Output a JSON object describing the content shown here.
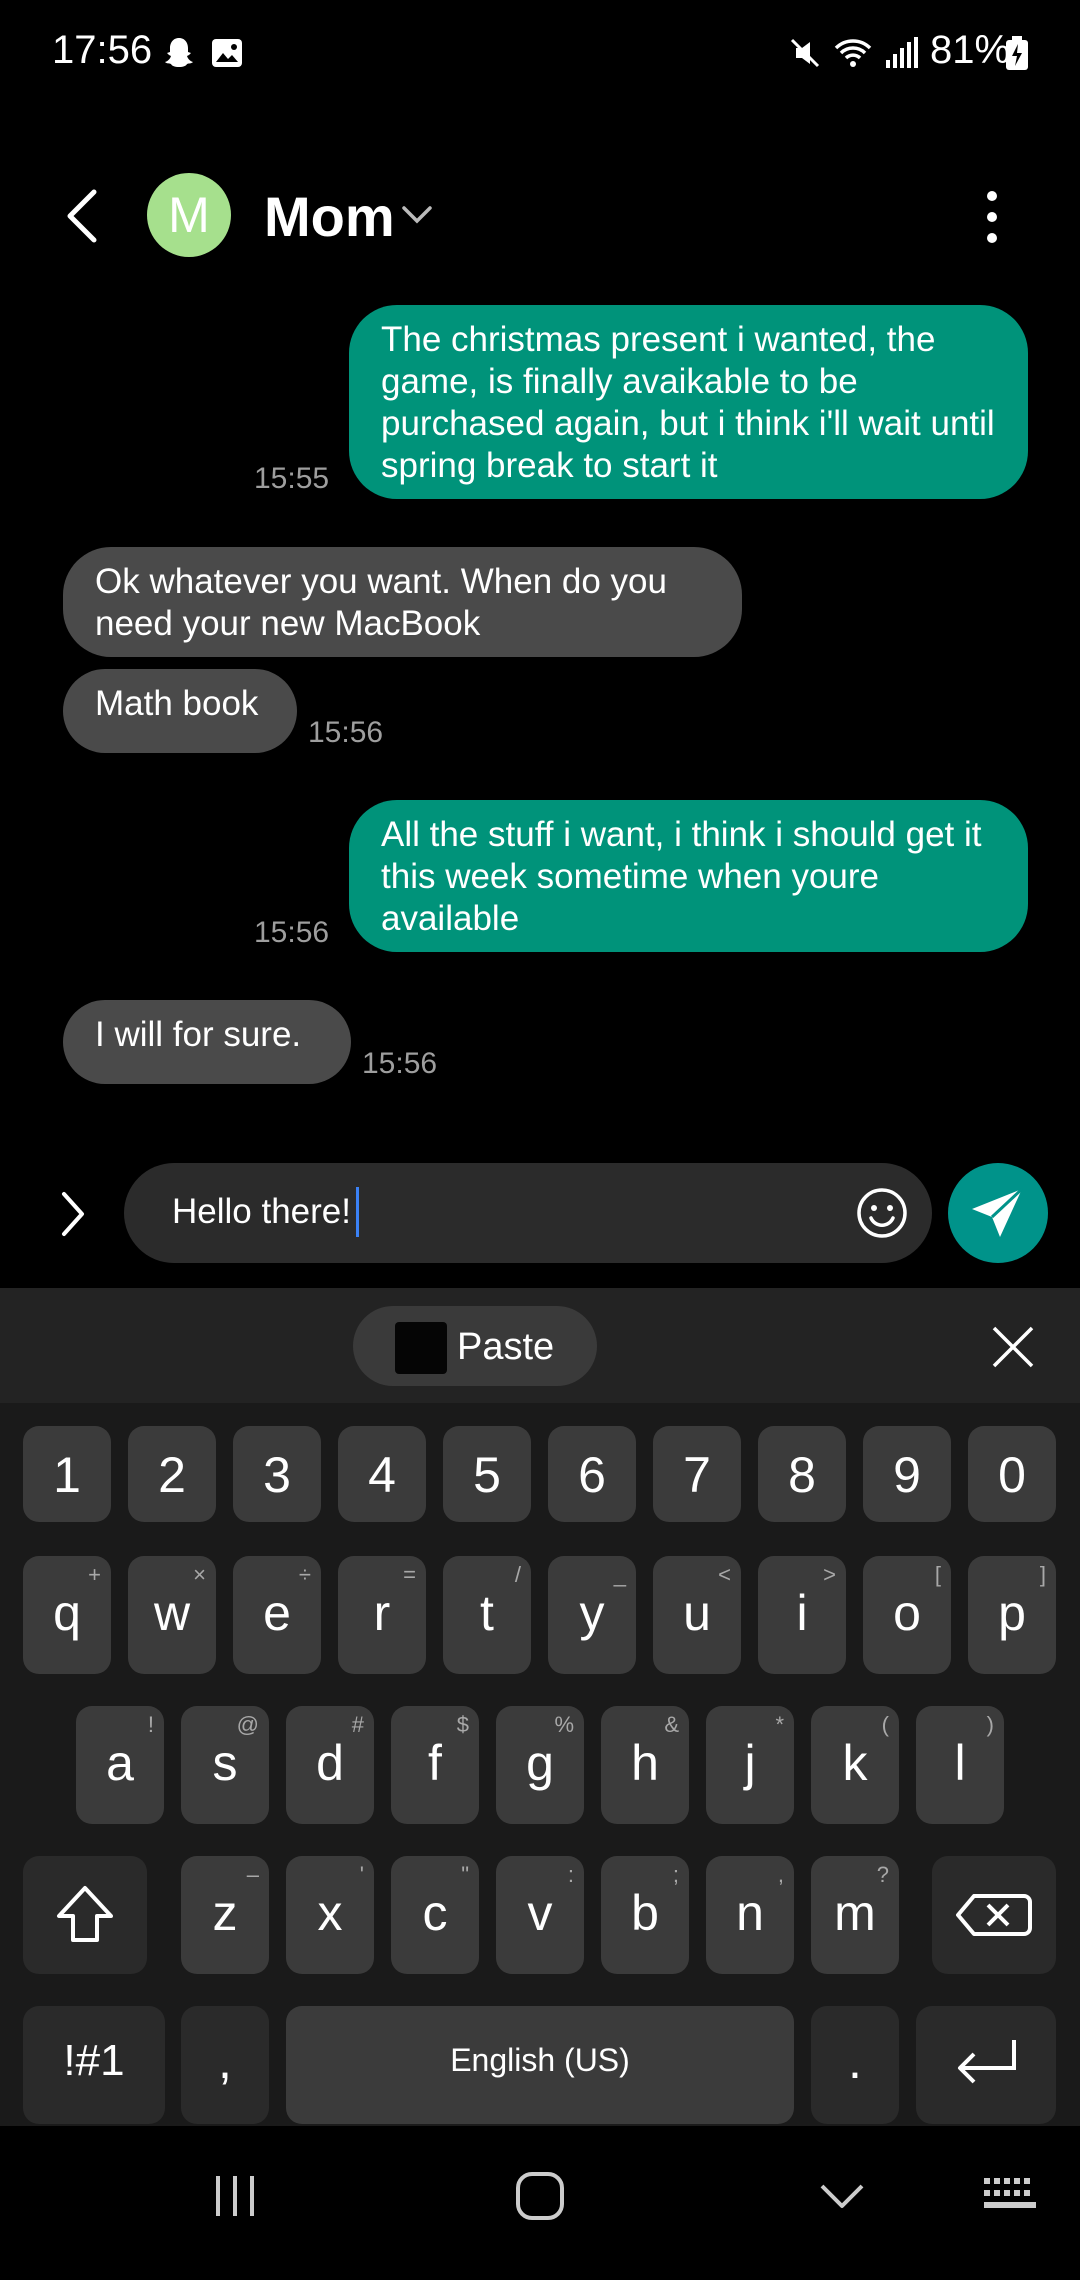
{
  "status_bar": {
    "time": "17:56",
    "battery": "81%",
    "icons": [
      "snapchat-icon",
      "gallery-icon",
      "mute-icon",
      "wifi-icon",
      "signal-icon",
      "battery-charging-icon"
    ]
  },
  "header": {
    "avatar_letter": "M",
    "contact_name": "Mom",
    "avatar_color": "#a6e08d"
  },
  "messages": [
    {
      "direction": "sent",
      "text": "The christmas present i wanted, the game, is finally avaikable to be purchased again, but i think i'll wait until spring break to start it",
      "time": "15:55"
    },
    {
      "direction": "received",
      "text": "Ok whatever you want. When do you need your new MacBook",
      "time": ""
    },
    {
      "direction": "received",
      "text": "Math book",
      "time": "15:56"
    },
    {
      "direction": "sent",
      "text": "All the stuff i want, i think i should get it this week sometime when youre available",
      "time": "15:56"
    },
    {
      "direction": "received",
      "text": "I will for sure.",
      "time": "15:56"
    }
  ],
  "composer": {
    "value": "Hello there!"
  },
  "keyboard": {
    "paste_label": "Paste",
    "number_row": [
      "1",
      "2",
      "3",
      "4",
      "5",
      "6",
      "7",
      "8",
      "9",
      "0"
    ],
    "row1": [
      {
        "key": "q",
        "hint": "+"
      },
      {
        "key": "w",
        "hint": "×"
      },
      {
        "key": "e",
        "hint": "÷"
      },
      {
        "key": "r",
        "hint": "="
      },
      {
        "key": "t",
        "hint": "/"
      },
      {
        "key": "y",
        "hint": "_"
      },
      {
        "key": "u",
        "hint": "<"
      },
      {
        "key": "i",
        "hint": ">"
      },
      {
        "key": "o",
        "hint": "["
      },
      {
        "key": "p",
        "hint": "]"
      }
    ],
    "row2": [
      {
        "key": "a",
        "hint": "!"
      },
      {
        "key": "s",
        "hint": "@"
      },
      {
        "key": "d",
        "hint": "#"
      },
      {
        "key": "f",
        "hint": "$"
      },
      {
        "key": "g",
        "hint": "%"
      },
      {
        "key": "h",
        "hint": "&"
      },
      {
        "key": "j",
        "hint": "*"
      },
      {
        "key": "k",
        "hint": "("
      },
      {
        "key": "l",
        "hint": ")"
      }
    ],
    "row3": [
      {
        "key": "z",
        "hint": "–"
      },
      {
        "key": "x",
        "hint": "'"
      },
      {
        "key": "c",
        "hint": "\""
      },
      {
        "key": "v",
        "hint": ":"
      },
      {
        "key": "b",
        "hint": ";"
      },
      {
        "key": "n",
        "hint": ","
      },
      {
        "key": "m",
        "hint": "?"
      }
    ],
    "symbols_label": "!#1",
    "comma_label": ",",
    "space_label": "English (US)",
    "period_label": "."
  },
  "colors": {
    "sent_bubble": "#00937a",
    "received_bubble": "#4a4a4a",
    "send_button": "#00938a",
    "caret": "#3b82f6"
  }
}
